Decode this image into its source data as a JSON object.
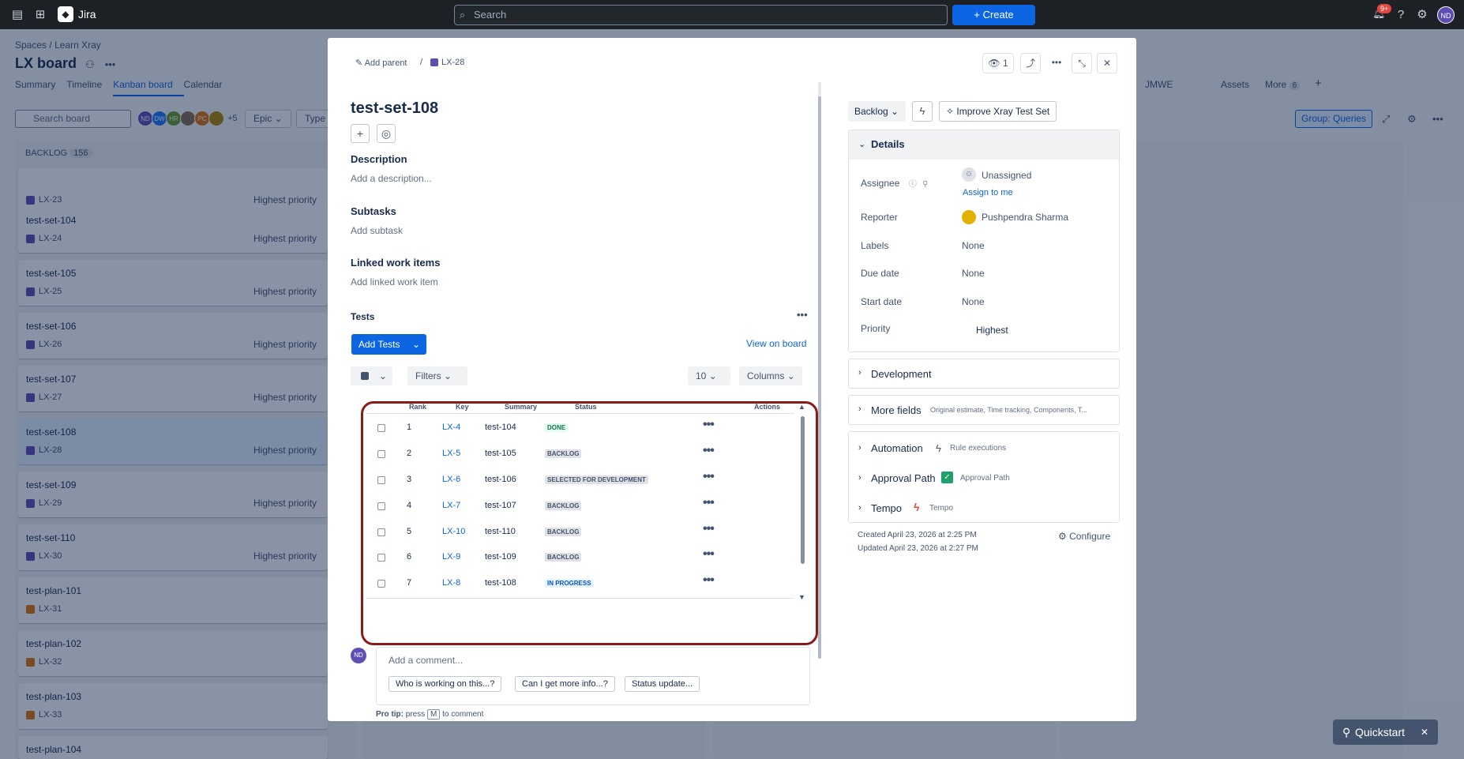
{
  "topbar": {
    "app_name": "Jira",
    "search_placeholder": "Search",
    "create_label": "Create",
    "notif_count": "9+",
    "user_initials": "ND"
  },
  "board": {
    "crumb_spaces": "Spaces",
    "crumb_sep": "/",
    "crumb_project": "Learn Xray",
    "title": "LX board",
    "tabs": [
      "Summary",
      "Timeline",
      "Kanban board",
      "Calendar"
    ],
    "right_tabs": [
      "JMWE",
      "Assets",
      "More"
    ],
    "more_count": "6",
    "search_placeholder": "Search board",
    "avatars": [
      "ND",
      "DW",
      "HR",
      "",
      "PC",
      ""
    ],
    "avatars_more": "+5",
    "filter_epic": "Epic",
    "filter_type": "Type",
    "group_label": "Group: Queries",
    "column_title": "BACKLOG",
    "column_count": "156",
    "cards": [
      {
        "title": "",
        "key": "LX-23",
        "priority": "Highest priority"
      },
      {
        "title": "test-set-104",
        "key": "LX-24",
        "priority": "Highest priority"
      },
      {
        "title": "test-set-105",
        "key": "LX-25",
        "priority": "Highest priority"
      },
      {
        "title": "test-set-106",
        "key": "LX-26",
        "priority": "Highest priority"
      },
      {
        "title": "test-set-107",
        "key": "LX-27",
        "priority": "Highest priority"
      },
      {
        "title": "test-set-108",
        "key": "LX-28",
        "priority": "Highest priority"
      },
      {
        "title": "test-set-109",
        "key": "LX-29",
        "priority": "Highest priority"
      },
      {
        "title": "test-set-110",
        "key": "LX-30",
        "priority": "Highest priority"
      },
      {
        "title": "test-plan-101",
        "key": "LX-31",
        "priority": ""
      },
      {
        "title": "test-plan-102",
        "key": "LX-32",
        "priority": ""
      },
      {
        "title": "test-plan-103",
        "key": "LX-33",
        "priority": ""
      },
      {
        "title": "test-plan-104",
        "key": "",
        "priority": ""
      }
    ]
  },
  "modal": {
    "add_parent": "Add parent",
    "sep": "/",
    "key": "LX-28",
    "watch_count": "1",
    "title": "test-set-108",
    "description_heading": "Description",
    "description_placeholder": "Add a description...",
    "subtasks_heading": "Subtasks",
    "subtasks_placeholder": "Add subtask",
    "linked_heading": "Linked work items",
    "linked_placeholder": "Add linked work item",
    "tests_heading": "Tests",
    "add_tests": "Add Tests",
    "view_on_board": "View on board",
    "filters": "Filters",
    "page_size": "10",
    "columns": "Columns",
    "table_headers": {
      "rank": "Rank",
      "key": "Key",
      "summary": "Summary",
      "status": "Status",
      "actions": "Actions"
    },
    "rows": [
      {
        "rank": "1",
        "key": "LX-4",
        "summary": "test-104",
        "status": "DONE",
        "kind": "done"
      },
      {
        "rank": "2",
        "key": "LX-5",
        "summary": "test-105",
        "status": "BACKLOG",
        "kind": "gray"
      },
      {
        "rank": "3",
        "key": "LX-6",
        "summary": "test-106",
        "status": "SELECTED FOR DEVELOPMENT",
        "kind": "gray"
      },
      {
        "rank": "4",
        "key": "LX-7",
        "summary": "test-107",
        "status": "BACKLOG",
        "kind": "gray"
      },
      {
        "rank": "5",
        "key": "LX-10",
        "summary": "test-110",
        "status": "BACKLOG",
        "kind": "gray"
      },
      {
        "rank": "6",
        "key": "LX-9",
        "summary": "test-109",
        "status": "BACKLOG",
        "kind": "gray"
      },
      {
        "rank": "7",
        "key": "LX-8",
        "summary": "test-108",
        "status": "IN PROGRESS",
        "kind": "blue"
      }
    ],
    "comment_avatar": "ND",
    "comment_placeholder": "Add a comment...",
    "suggestions": [
      "Who is working on this...?",
      "Can I get more info...?",
      "Status update..."
    ],
    "pro_tip_label": "Pro tip:",
    "pro_tip_press": "press",
    "pro_tip_key": "M",
    "pro_tip_rest": "to comment",
    "status_button": "Backlog",
    "improve_button": "Improve Xray Test Set",
    "details_heading": "Details",
    "fields": {
      "assignee_label": "Assignee",
      "assignee_value": "Unassigned",
      "assign_to_me": "Assign to me",
      "reporter_label": "Reporter",
      "reporter_value": "Pushpendra Sharma",
      "labels_label": "Labels",
      "labels_value": "None",
      "due_label": "Due date",
      "due_value": "None",
      "start_label": "Start date",
      "start_value": "None",
      "priority_label": "Priority",
      "priority_value": "Highest"
    },
    "development": "Development",
    "more_fields": "More fields",
    "more_fields_hint": "Original estimate, Time tracking, Components, T...",
    "automation": "Automation",
    "rule_exec": "Rule executions",
    "approval": "Approval Path",
    "approval_hint": "Approval Path",
    "tempo": "Tempo",
    "tempo_hint": "Tempo",
    "created": "Created April 23, 2026 at 2:25 PM",
    "updated": "Updated April 23, 2026 at 2:27 PM",
    "configure": "Configure"
  },
  "quickstart": "Quickstart"
}
